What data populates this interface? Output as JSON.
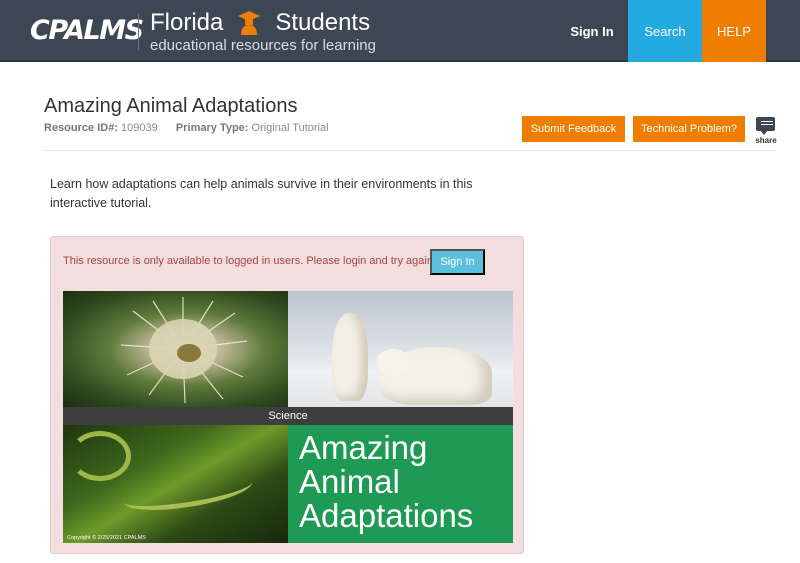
{
  "header": {
    "logo_text": "CPALMS",
    "brand_word1": "Florida",
    "brand_word2": "Students",
    "brand_subtitle": "educational resources for learning",
    "nav": {
      "signin": "Sign In",
      "search": "Search",
      "help": "HELP"
    },
    "colors": {
      "bar": "#3d4754",
      "search": "#24a9e1",
      "help": "#ef7d00"
    }
  },
  "resource": {
    "title": "Amazing Animal Adaptations",
    "id_label": "Resource ID#:",
    "id_value": "109039",
    "type_label": "Primary Type:",
    "type_value": "Original Tutorial",
    "feedback_label": "Submit Feedback",
    "tech_label": "Technical Problem?",
    "share_label": "share",
    "description": "Learn how adaptations can help animals survive in their environments in this interactive tutorial."
  },
  "alert": {
    "message": "This resource is only available to logged in users. Please login and try again.",
    "signin_label": "Sign In"
  },
  "banner": {
    "subject": "Science",
    "title_lines": [
      "Amazing",
      "Animal",
      "Adaptations"
    ],
    "copyright": "Copyright © 2/25/2021 CPALMS",
    "panel_color": "#1f9a54"
  },
  "icons": [
    "brand-student-icon",
    "share-icon"
  ]
}
